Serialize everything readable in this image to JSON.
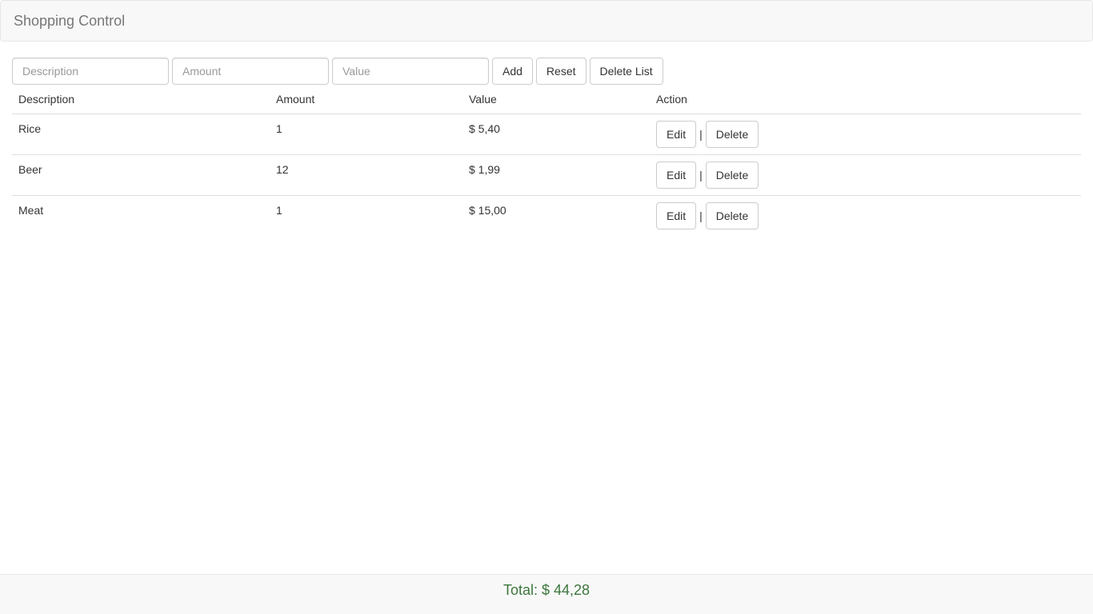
{
  "header": {
    "title": "Shopping Control"
  },
  "form": {
    "description_placeholder": "Description",
    "amount_placeholder": "Amount",
    "value_placeholder": "Value",
    "add_label": "Add",
    "reset_label": "Reset",
    "delete_list_label": "Delete List"
  },
  "table": {
    "headers": [
      "Description",
      "Amount",
      "Value",
      "Action"
    ],
    "rows": [
      {
        "description": "Rice",
        "amount": "1",
        "value": "$ 5,40"
      },
      {
        "description": "Beer",
        "amount": "12",
        "value": "$ 1,99"
      },
      {
        "description": "Meat",
        "amount": "1",
        "value": "$ 15,00"
      }
    ],
    "edit_label": "Edit",
    "delete_label": "Delete",
    "separator": "|"
  },
  "footer": {
    "total": "Total: $ 44,28"
  },
  "colors": {
    "navbar_bg": "#f8f8f8",
    "total_text": "#3c763d",
    "border": "#cccccc"
  }
}
